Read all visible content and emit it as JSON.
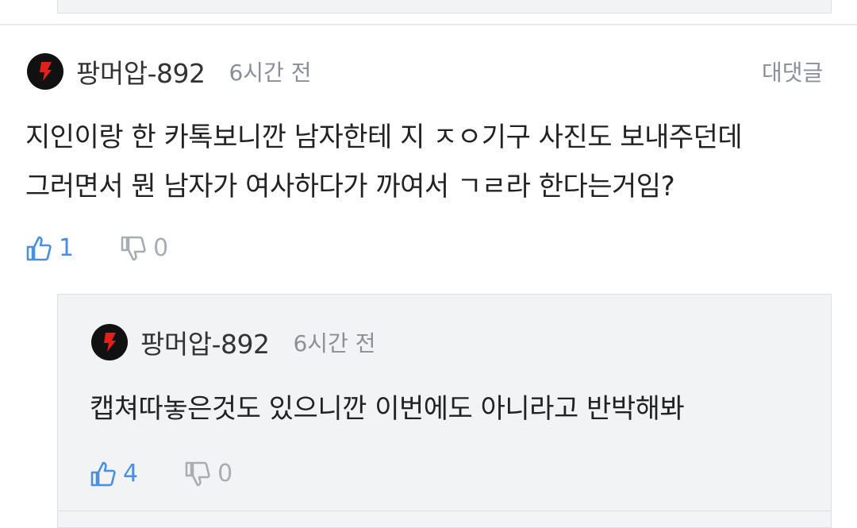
{
  "comment": {
    "author": "팡머압-892",
    "time": "6시간 전",
    "reply_label": "대댓글",
    "body_line1": "지인이랑 한 카톡보니깐 남자한테 지 ㅈㅇ기구 사진도 보내주던데",
    "body_line2": "그러면서 뭔 남자가 여사하다가 까여서 ㄱㄹ라 한다는거임?",
    "likes": "1",
    "dislikes": "0"
  },
  "reply": {
    "author": "팡머압-892",
    "time": "6시간 전",
    "body": "캡쳐따놓은것도 있으니깐 이번에도 아니라고 반박해봐",
    "likes": "4",
    "dislikes": "0"
  },
  "colors": {
    "accent_like": "#4a8fe0",
    "muted": "#8a8f99",
    "reply_background": "#f2f3f5",
    "avatar_bg": "#111111",
    "avatar_mark": "#e0201b"
  }
}
